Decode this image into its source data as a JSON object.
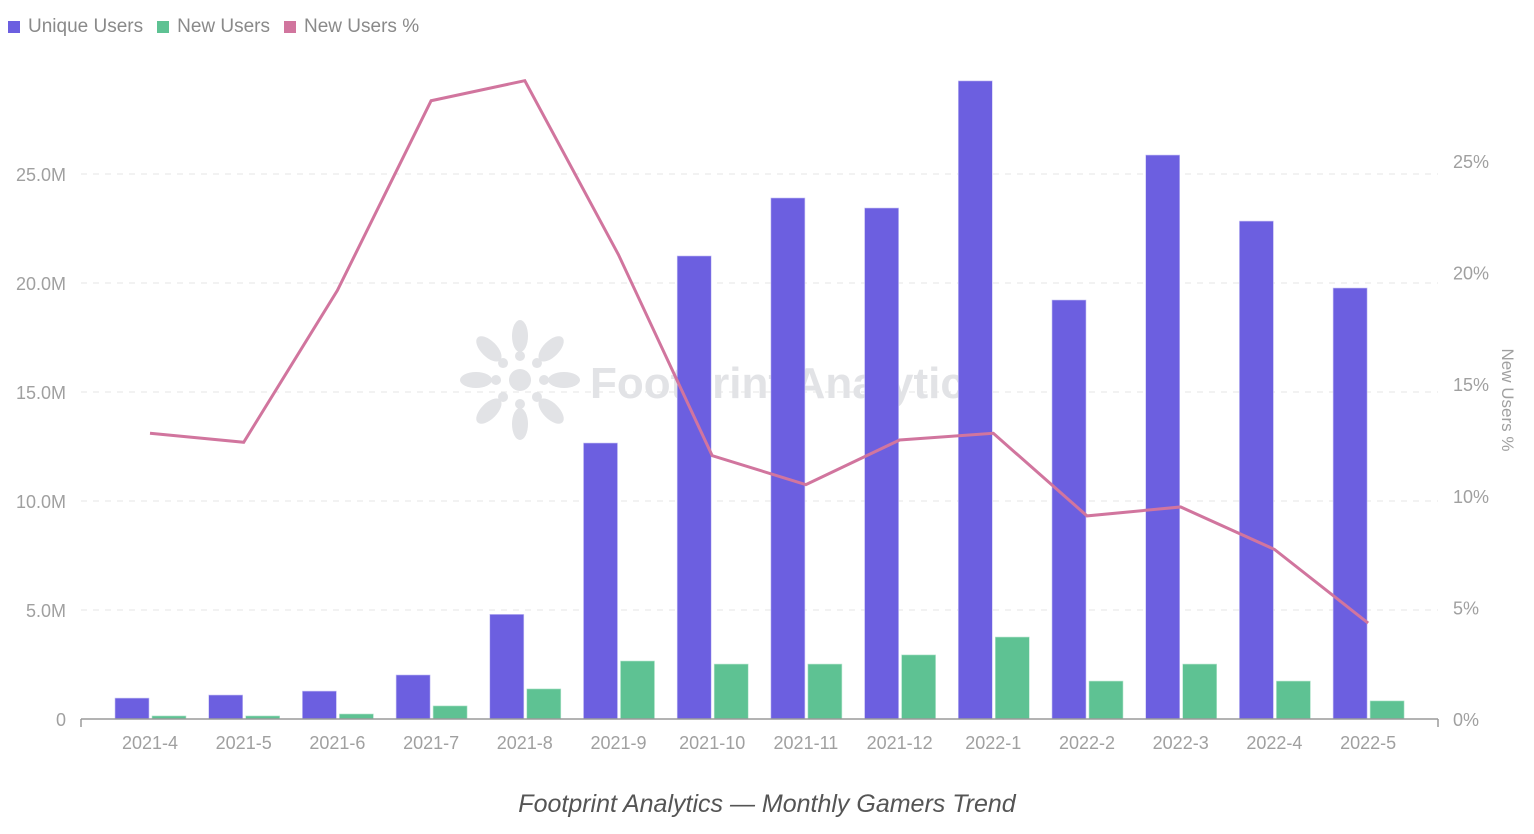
{
  "caption": "Footprint Analytics — Monthly Gamers Trend",
  "watermark": "Footprint Analytics",
  "colors": {
    "unique_users": "#6c5fe0",
    "new_users": "#5ec293",
    "new_users_pct": "#d1759e",
    "grid": "#e6e6e6",
    "axis": "#9a9a9a",
    "tick_text": "#a0a0a0",
    "watermark": "#e2e3e6"
  },
  "legend": [
    {
      "label": "Unique Users",
      "color": "#6c5fe0"
    },
    {
      "label": "New Users",
      "color": "#5ec293"
    },
    {
      "label": "New Users %",
      "color": "#d1759e"
    }
  ],
  "chart_data": {
    "type": "bar",
    "title": "",
    "xlabel": "",
    "ylabel": "",
    "y2label": "New Users %",
    "categories": [
      "2021-4",
      "2021-5",
      "2021-6",
      "2021-7",
      "2021-8",
      "2021-9",
      "2021-10",
      "2021-11",
      "2021-12",
      "2022-1",
      "2022-2",
      "2022-3",
      "2022-4",
      "2022-5"
    ],
    "series": [
      {
        "name": "Unique Users",
        "type": "bar",
        "axis": "left",
        "unit": "M",
        "values": [
          0.96,
          1.1,
          1.28,
          2.02,
          4.8,
          12.66,
          21.24,
          23.9,
          23.44,
          29.27,
          19.22,
          25.87,
          22.84,
          19.77
        ]
      },
      {
        "name": "New Users",
        "type": "bar",
        "axis": "left",
        "unit": "M",
        "values": [
          0.14,
          0.14,
          0.23,
          0.6,
          1.38,
          2.66,
          2.52,
          2.52,
          2.94,
          3.76,
          1.74,
          2.52,
          1.74,
          0.83
        ]
      },
      {
        "name": "New Users %",
        "type": "line",
        "axis": "right",
        "unit": "%",
        "values": [
          12.8,
          12.4,
          19.2,
          27.7,
          28.6,
          20.8,
          11.8,
          10.5,
          12.5,
          12.8,
          9.1,
          9.5,
          7.6,
          4.3
        ]
      }
    ],
    "ylim": [
      0,
      29.27
    ],
    "y2lim": [
      0,
      28.6
    ],
    "yticks": [
      0,
      5,
      10,
      15,
      20,
      25
    ],
    "ytick_labels": [
      "0",
      "5.0M",
      "10.0M",
      "15.0M",
      "20.0M",
      "25.0M"
    ],
    "y2ticks": [
      0,
      5,
      10,
      15,
      20,
      25
    ],
    "y2tick_labels": [
      "0%",
      "5%",
      "10%",
      "15%",
      "20%",
      "25%"
    ],
    "grid": true,
    "legend_position": "top-left"
  }
}
